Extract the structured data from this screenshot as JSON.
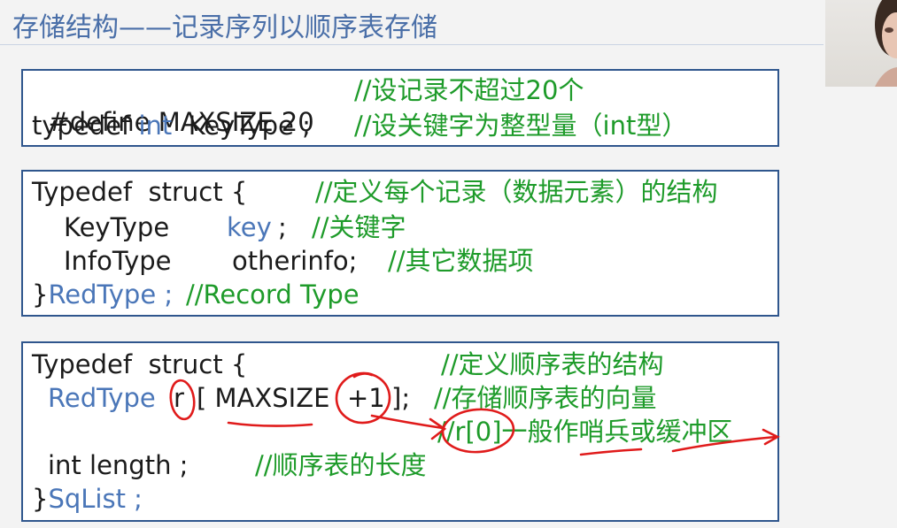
{
  "slide": {
    "title": "存储结构——记录序列以顺序表存储"
  },
  "box1": {
    "line1_code": "#define MAXSIZE 20",
    "line1_comment": "//设记录不超过20个",
    "line2_code_a": "typedef ",
    "line2_kw": "int",
    "line2_code_b": "  KeyType ;",
    "line2_comment": "//设关键字为整型量（int型）"
  },
  "box2": {
    "line1_code": "Typedef  struct {",
    "line1_comment": "//定义每个记录（数据元素）的结构",
    "line2_code": "KeyType",
    "line2_kw": "key",
    "line2_semicolon": ";",
    "line2_comment": "//关键字",
    "line3_code": "InfoType",
    "line3_field": "otherinfo;",
    "line3_comment": "//其它数据项",
    "line4_brace": "}",
    "line4_kw": "RedType ;",
    "line4_comment": "//Record Type"
  },
  "box3": {
    "line1_code": "Typedef  struct {",
    "line1_comment": "//定义顺序表的结构",
    "line2_kw": "RedType",
    "line2_r": "r",
    "line2_open": "[ MAXSIZE",
    "line2_plus": "+1",
    "line2_close": "];",
    "line2_comment": "//存储顺序表的向量",
    "line3_comment": "//r[0]一般作哨兵或缓冲区",
    "line4_code": "int length ;",
    "line4_comment": "//顺序表的长度",
    "line5_brace": "}",
    "line5_kw": "SqList ;"
  },
  "colors": {
    "title": "#4a6fa8",
    "keyword": "#4a76b8",
    "comment": "#1e9b2a",
    "box_border": "#2f568d",
    "annotation_ink": "#e01b1b"
  }
}
